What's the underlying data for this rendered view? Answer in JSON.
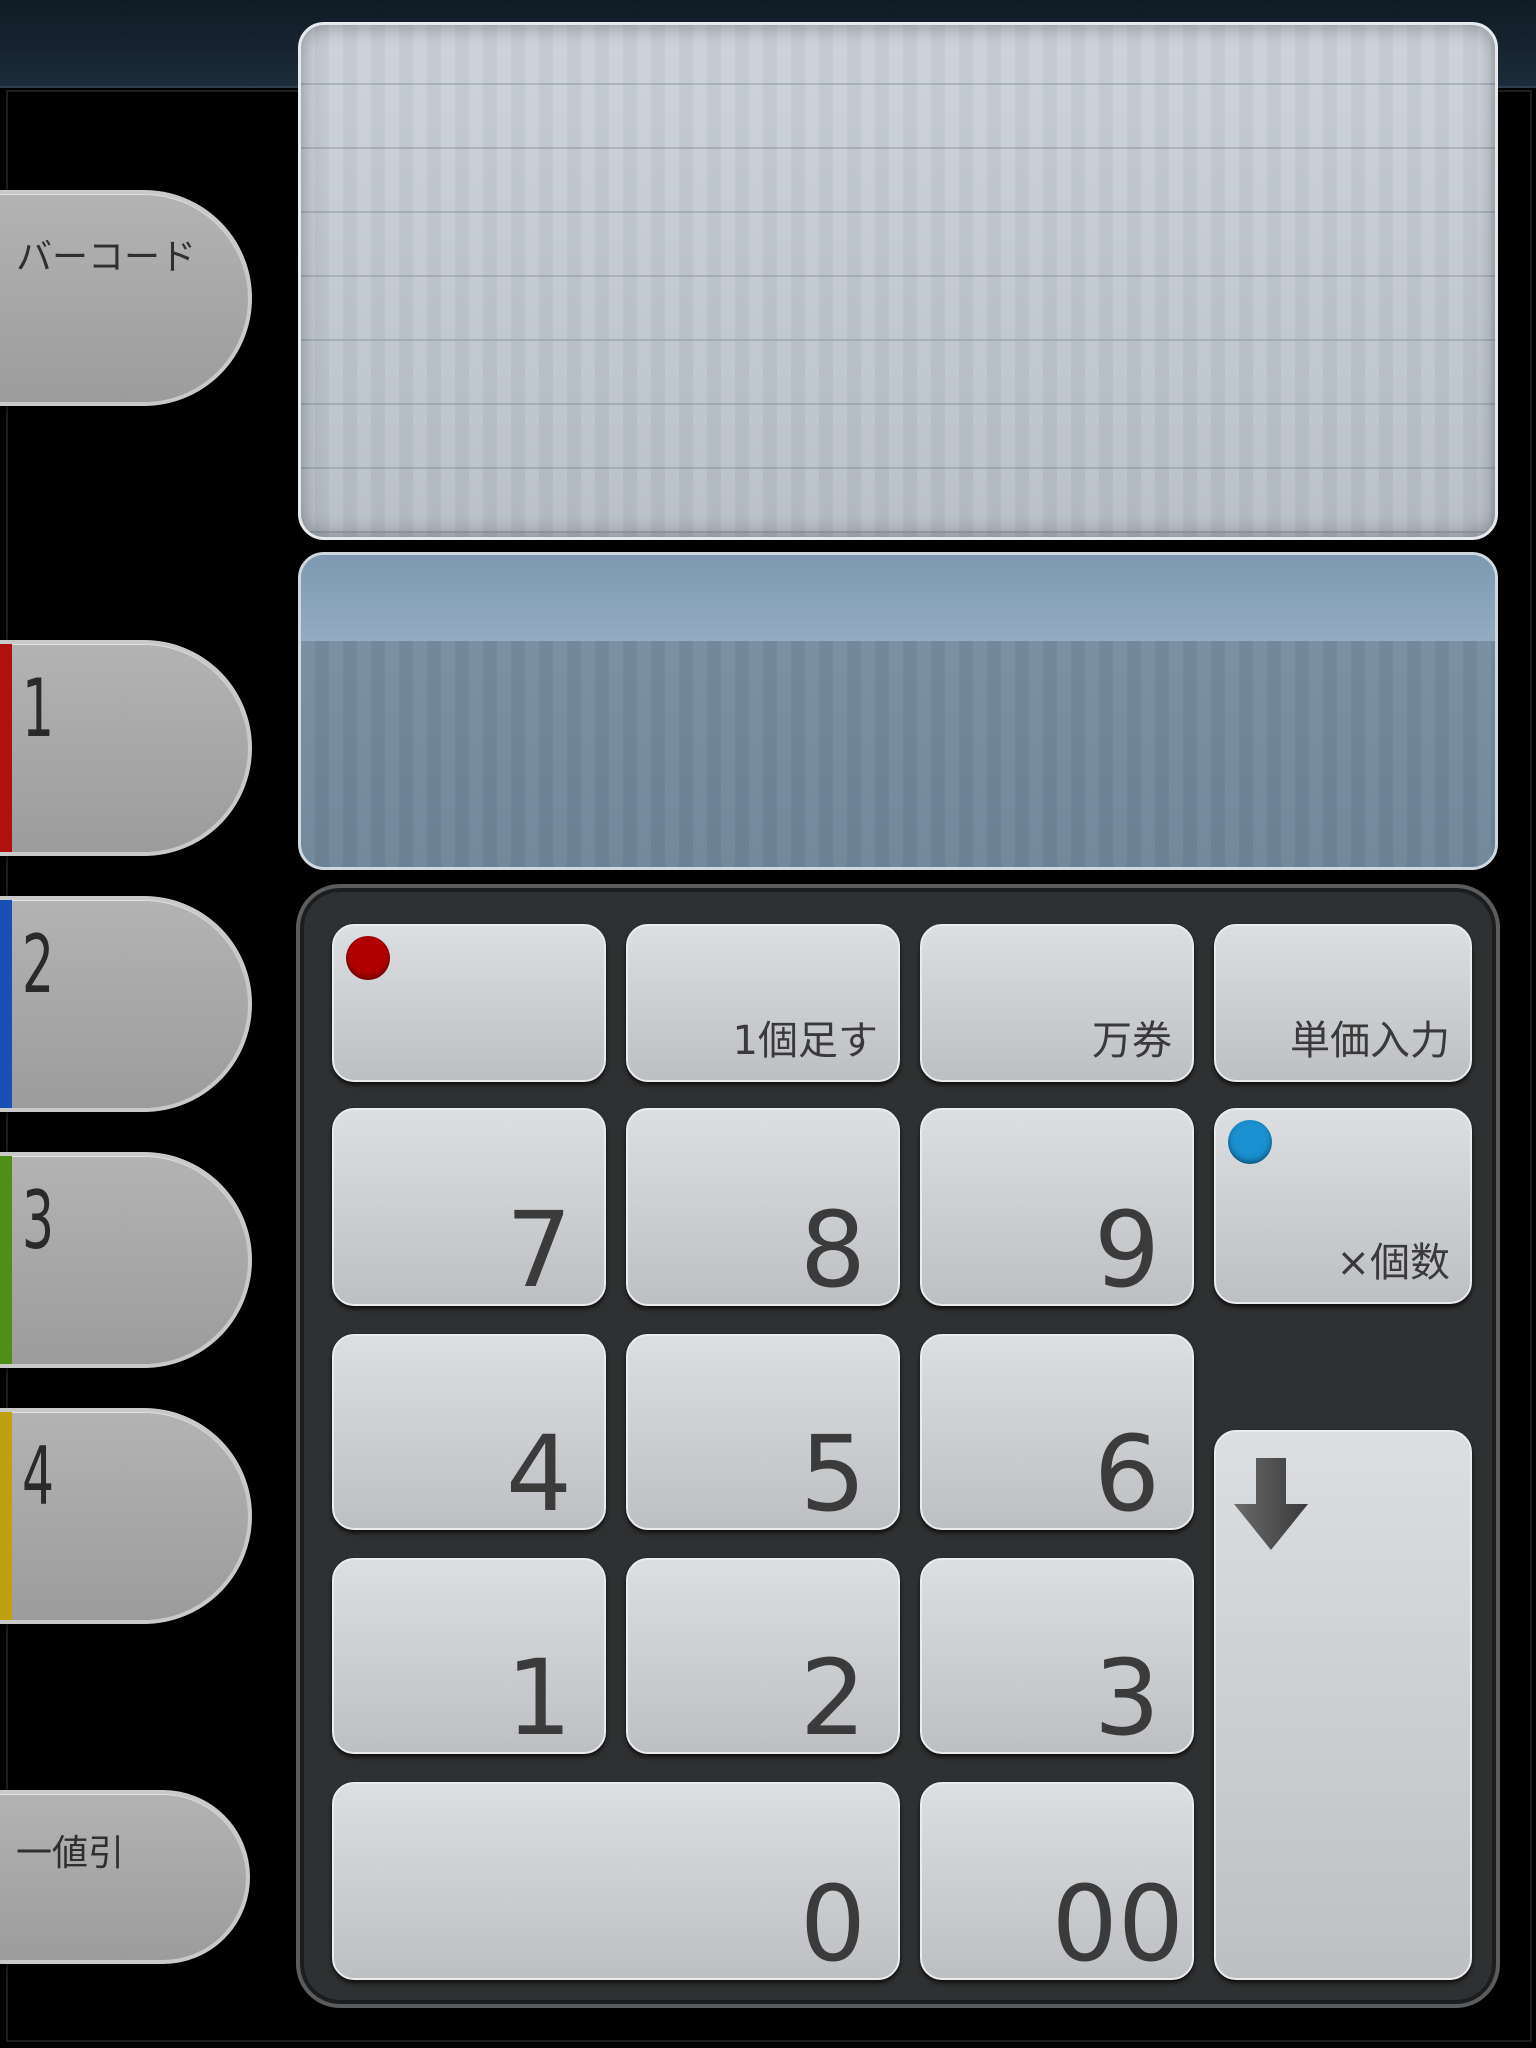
{
  "sidebar": {
    "barcode": "バーコード",
    "discount": "一値引",
    "departments": [
      {
        "label": "1",
        "color": "#b01010"
      },
      {
        "label": "2",
        "color": "#1a4fb5"
      },
      {
        "label": "3",
        "color": "#4f8f18"
      },
      {
        "label": "4",
        "color": "#bfa010"
      }
    ]
  },
  "keypad": {
    "function_keys": {
      "blank": "",
      "add_one": "1個足す",
      "ten_thousand": "万券",
      "unit_price": "単価入力",
      "quantity": "×個数"
    },
    "digits": {
      "d7": "7",
      "d8": "8",
      "d9": "9",
      "d4": "4",
      "d5": "5",
      "d6": "6",
      "d1": "1",
      "d2": "2",
      "d3": "3",
      "d0": "0",
      "d00": "00"
    },
    "indicator_colors": {
      "red": "#b00000",
      "blue": "#1a90d0"
    },
    "enter_icon": "down-arrow-icon"
  }
}
